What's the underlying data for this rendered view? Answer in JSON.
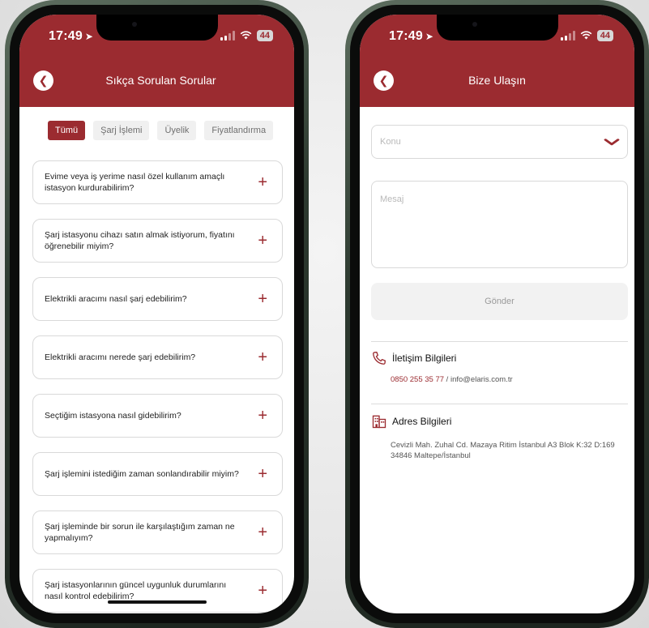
{
  "status_bar": {
    "time": "17:49",
    "battery": "44"
  },
  "faq_screen": {
    "title": "Sıkça Sorulan Sorular",
    "tabs": [
      {
        "label": "Tümü",
        "active": true
      },
      {
        "label": "Şarj İşlemi",
        "active": false
      },
      {
        "label": "Üyelik",
        "active": false
      },
      {
        "label": "Fiyatlandırma",
        "active": false
      }
    ],
    "questions": [
      "Evime veya iş yerime nasıl özel kullanım amaçlı istasyon kurdurabilirim?",
      "Şarj istasyonu cihazı satın almak istiyorum, fiyatını öğrenebilir miyim?",
      "Elektrikli aracımı nasıl şarj edebilirim?",
      "Elektrikli aracımı nerede şarj edebilirim?",
      "Seçtiğim istasyona nasıl gidebilirim?",
      "Şarj işlemini istediğim zaman sonlandırabilir miyim?",
      "Şarj işleminde bir sorun ile karşılaştığım zaman ne yapmalıyım?",
      "Şarj istasyonlarının güncel uygunluk durumlarını nasıl kontrol edebilirim?"
    ],
    "expand_symbol": "+"
  },
  "contact_screen": {
    "title": "Bize Ulaşın",
    "subject_placeholder": "Konu",
    "message_placeholder": "Mesaj",
    "send_label": "Gönder",
    "contact_info_title": "İletişim Bilgileri",
    "phone": "0850 255 35 77",
    "separator": " / ",
    "email": "info@elaris.com.tr",
    "address_title": "Adres Bilgileri",
    "address": "Cevizli Mah. Zuhal Cd. Mazaya Ritim İstanbul A3 Blok K:32 D:169 34846 Maltepe/İstanbul"
  },
  "colors": {
    "brand": "#9b2b30",
    "border": "#d9d9d9",
    "muted": "#f2f2f2"
  },
  "icons": {
    "back": "chevron-left-icon",
    "dropdown": "chevron-down-icon",
    "phone": "phone-icon",
    "address": "building-icon"
  }
}
